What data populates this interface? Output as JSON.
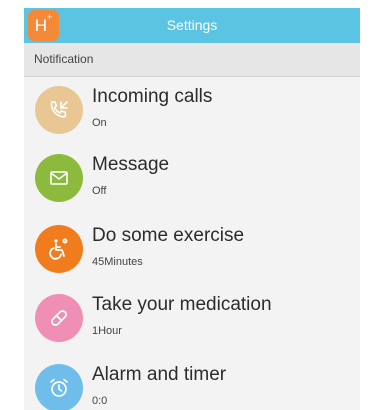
{
  "app": {
    "icon_letter": "H",
    "icon_mark": "+",
    "title": "Settings"
  },
  "section": {
    "title": "Notification"
  },
  "items": [
    {
      "label": "Incoming calls",
      "value": "On",
      "icon": "incoming-call-icon",
      "color": "#e8c795"
    },
    {
      "label": "Message",
      "value": "Off",
      "icon": "envelope-icon",
      "color": "#8cba3c"
    },
    {
      "label": "Do some exercise",
      "value": "45Minutes",
      "icon": "wheelchair-icon",
      "color": "#f07c1e"
    },
    {
      "label": "Take your medication",
      "value": "1Hour",
      "icon": "pill-icon",
      "color": "#ef8fb3"
    },
    {
      "label": "Alarm and timer",
      "value": "0:0",
      "icon": "alarm-clock-icon",
      "color": "#6ebdeb"
    }
  ],
  "colors": {
    "header": "#5bc4e3",
    "app_icon": "#f28a3a",
    "background": "#f3f3f3",
    "section_header": "#e6e6e6"
  }
}
